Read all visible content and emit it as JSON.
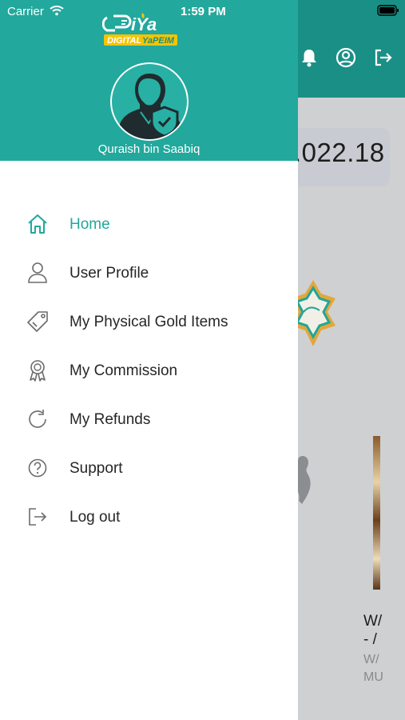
{
  "status_bar": {
    "carrier": "Carrier",
    "time": "1:59 PM"
  },
  "app": {
    "logo_text_main": "iYa",
    "logo_text_sub_left": "DIGITAL",
    "logo_text_sub_right": "YaPEIM",
    "accent_color": "#22a89c",
    "header_color": "#1a8f86"
  },
  "drawer": {
    "user_name": "Quraish bin Saabiq",
    "menu": [
      {
        "label": "Home",
        "icon": "home-icon",
        "active": true
      },
      {
        "label": "User Profile",
        "icon": "user-icon",
        "active": false
      },
      {
        "label": "My Physical Gold Items",
        "icon": "tag-icon",
        "active": false
      },
      {
        "label": "My Commission",
        "icon": "award-icon",
        "active": false
      },
      {
        "label": "My Refunds",
        "icon": "refresh-icon",
        "active": false
      },
      {
        "label": "Support",
        "icon": "help-circle-icon",
        "active": false
      },
      {
        "label": "Log out",
        "icon": "logout-icon",
        "active": false
      }
    ]
  },
  "background_screen": {
    "header_icons": [
      "bell-icon",
      "profile-circle-icon",
      "logout-icon"
    ],
    "balance_partial": ".022.18",
    "item_title_line1": "W/",
    "item_title_line2": "- /",
    "item_sub_line1": "W/",
    "item_sub_line2": "MU"
  }
}
